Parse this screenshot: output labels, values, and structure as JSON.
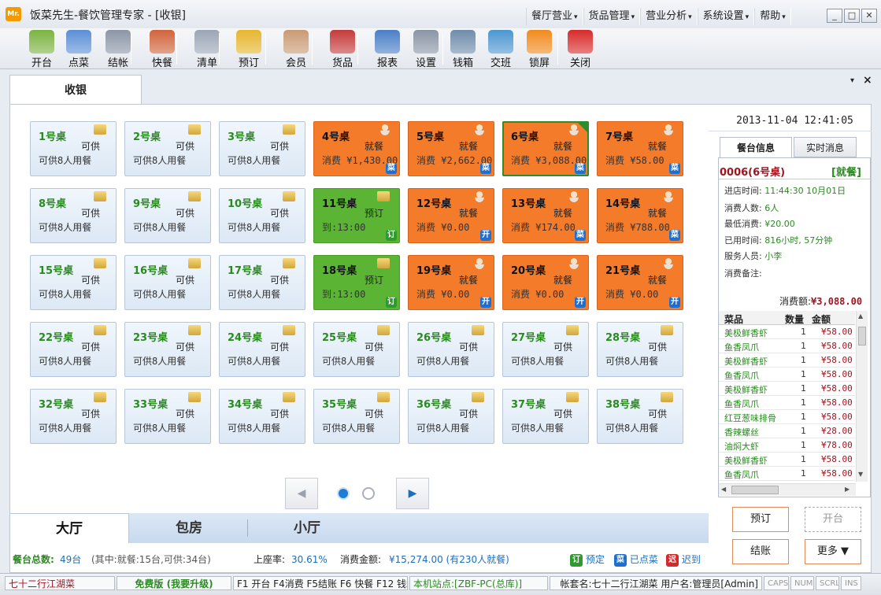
{
  "app": {
    "logo": "Mr.",
    "title": "饭菜先生-餐饮管理专家 - [收银]"
  },
  "menu": [
    "餐厅营业",
    "货品管理",
    "营业分析",
    "系统设置",
    "帮助"
  ],
  "window_buttons": {
    "minimize": "_",
    "maximize": "□",
    "close": "✕"
  },
  "toolbar": [
    {
      "label": "开台",
      "icon": "open-table-icon",
      "color": "#7cb342"
    },
    {
      "label": "点菜",
      "icon": "order-dish-icon",
      "color": "#5b8fd6"
    },
    {
      "label": "结帐",
      "icon": "checkout-icon",
      "color": "#8b96a6"
    },
    {
      "label": "快餐",
      "icon": "fast-food-icon",
      "color": "#d0643b"
    },
    {
      "label": "清单",
      "icon": "list-icon",
      "color": "#9aa6b6"
    },
    {
      "label": "预订",
      "icon": "reservation-clock-icon",
      "color": "#e6b62e"
    },
    {
      "label": "会员",
      "icon": "member-icon",
      "color": "#c99a73"
    },
    {
      "label": "货品",
      "icon": "goods-icon",
      "color": "#c43b3b"
    },
    {
      "label": "报表",
      "icon": "report-icon",
      "color": "#4a7fc7"
    },
    {
      "label": "设置",
      "icon": "settings-gears-icon",
      "color": "#8a95a4"
    },
    {
      "label": "钱箱",
      "icon": "cash-box-icon",
      "color": "#6f8cab"
    },
    {
      "label": "交班",
      "icon": "shift-handover-icon",
      "color": "#4c96d1"
    },
    {
      "label": "锁屏",
      "icon": "lock-screen-icon",
      "color": "#f08a1c"
    },
    {
      "label": "关闭",
      "icon": "power-icon",
      "color": "#d82b2b"
    }
  ],
  "main_tab": "收银",
  "tables": [
    {
      "name": "1号桌",
      "status": "可供",
      "info": "可供8人用餐",
      "state": "free"
    },
    {
      "name": "2号桌",
      "status": "可供",
      "info": "可供8人用餐",
      "state": "free"
    },
    {
      "name": "3号桌",
      "status": "可供",
      "info": "可供8人用餐",
      "state": "free"
    },
    {
      "name": "4号桌",
      "status": "就餐",
      "info": "消费 ¥1,430.00",
      "state": "dining",
      "badge": "菜"
    },
    {
      "name": "5号桌",
      "status": "就餐",
      "info": "消费 ¥2,662.00",
      "state": "dining",
      "badge": "菜"
    },
    {
      "name": "6号桌",
      "status": "就餐",
      "info": "消费 ¥3,088.00",
      "state": "dining",
      "badge": "菜",
      "selected": true
    },
    {
      "name": "7号桌",
      "status": "就餐",
      "info": "消费 ¥58.00",
      "state": "dining",
      "badge": "菜"
    },
    {
      "name": "8号桌",
      "status": "可供",
      "info": "可供8人用餐",
      "state": "free"
    },
    {
      "name": "9号桌",
      "status": "可供",
      "info": "可供8人用餐",
      "state": "free"
    },
    {
      "name": "10号桌",
      "status": "可供",
      "info": "可供8人用餐",
      "state": "free"
    },
    {
      "name": "11号桌",
      "status": "预订",
      "info": "到:13:00",
      "state": "reserved",
      "badge": "订"
    },
    {
      "name": "12号桌",
      "status": "就餐",
      "info": "消费 ¥0.00",
      "state": "dining",
      "badge": "开"
    },
    {
      "name": "13号桌",
      "status": "就餐",
      "info": "消费 ¥174.00",
      "state": "dining",
      "badge": "菜"
    },
    {
      "name": "14号桌",
      "status": "就餐",
      "info": "消费 ¥788.00",
      "state": "dining",
      "badge": "菜"
    },
    {
      "name": "15号桌",
      "status": "可供",
      "info": "可供8人用餐",
      "state": "free"
    },
    {
      "name": "16号桌",
      "status": "可供",
      "info": "可供8人用餐",
      "state": "free"
    },
    {
      "name": "17号桌",
      "status": "可供",
      "info": "可供8人用餐",
      "state": "free"
    },
    {
      "name": "18号桌",
      "status": "预订",
      "info": "到:13:00",
      "state": "reserved",
      "badge": "订"
    },
    {
      "name": "19号桌",
      "status": "就餐",
      "info": "消费 ¥0.00",
      "state": "dining",
      "badge": "开"
    },
    {
      "name": "20号桌",
      "status": "就餐",
      "info": "消费 ¥0.00",
      "state": "dining",
      "badge": "开"
    },
    {
      "name": "21号桌",
      "status": "就餐",
      "info": "消费 ¥0.00",
      "state": "dining",
      "badge": "开"
    },
    {
      "name": "22号桌",
      "status": "可供",
      "info": "可供8人用餐",
      "state": "free"
    },
    {
      "name": "23号桌",
      "status": "可供",
      "info": "可供8人用餐",
      "state": "free"
    },
    {
      "name": "24号桌",
      "status": "可供",
      "info": "可供8人用餐",
      "state": "free"
    },
    {
      "name": "25号桌",
      "status": "可供",
      "info": "可供8人用餐",
      "state": "free"
    },
    {
      "name": "26号桌",
      "status": "可供",
      "info": "可供8人用餐",
      "state": "free"
    },
    {
      "name": "27号桌",
      "status": "可供",
      "info": "可供8人用餐",
      "state": "free"
    },
    {
      "name": "28号桌",
      "status": "可供",
      "info": "可供8人用餐",
      "state": "free"
    },
    {
      "name": "32号桌",
      "status": "可供",
      "info": "可供8人用餐",
      "state": "free"
    },
    {
      "name": "33号桌",
      "status": "可供",
      "info": "可供8人用餐",
      "state": "free"
    },
    {
      "name": "34号桌",
      "status": "可供",
      "info": "可供8人用餐",
      "state": "free"
    },
    {
      "name": "35号桌",
      "status": "可供",
      "info": "可供8人用餐",
      "state": "free"
    },
    {
      "name": "36号桌",
      "status": "可供",
      "info": "可供8人用餐",
      "state": "free"
    },
    {
      "name": "37号桌",
      "status": "可供",
      "info": "可供8人用餐",
      "state": "free"
    },
    {
      "name": "38号桌",
      "status": "可供",
      "info": "可供8人用餐",
      "state": "free"
    }
  ],
  "pager": {
    "prev": "◀",
    "next": "▶"
  },
  "area_tabs": [
    "大厅",
    "包房",
    "小厅"
  ],
  "summary": {
    "total_label": "餐台总数:",
    "total_value": "49台",
    "total_detail": "(其中:就餐:15台,可供:34台)",
    "occupancy_label": "上座率:",
    "occupancy_value": "30.61%",
    "amount_label": "消费金额:",
    "amount_value": "¥15,274.00 (有230人就餐)",
    "legend": [
      {
        "badge": "订",
        "label": "预定",
        "color": "#2f9a2f"
      },
      {
        "badge": "菜",
        "label": "已点菜",
        "color": "#1f6fd1"
      },
      {
        "badge": "迟",
        "label": "迟到",
        "color": "#d22b2b"
      }
    ]
  },
  "right_panel": {
    "datetime": "2013-11-04 12:41:05",
    "tabs": [
      "餐台信息",
      "实时消息"
    ],
    "order_id": "0006(6号桌)",
    "order_state": "[就餐]",
    "fields": [
      {
        "label": "进店时间:",
        "value": "11:44:30 10月01日"
      },
      {
        "label": "消费人数:",
        "value": "6人"
      },
      {
        "label": "最低消费:",
        "value": "¥20.00"
      },
      {
        "label": "已用时间:",
        "value": "816小时, 57分钟"
      },
      {
        "label": "服务人员:",
        "value": "小李"
      },
      {
        "label": "消费备注:",
        "value": ""
      }
    ],
    "total_label": "消费额:",
    "total_value": "¥3,088.00",
    "order_columns": [
      "菜品",
      "数量",
      "金额"
    ],
    "order_items": [
      {
        "name": "美极鲜香虾",
        "qty": "1",
        "amount": "¥58.00"
      },
      {
        "name": "鱼香凤爪",
        "qty": "1",
        "amount": "¥58.00"
      },
      {
        "name": "美极鲜香虾",
        "qty": "1",
        "amount": "¥58.00"
      },
      {
        "name": "鱼香凤爪",
        "qty": "1",
        "amount": "¥58.00"
      },
      {
        "name": "美极鲜香虾",
        "qty": "1",
        "amount": "¥58.00"
      },
      {
        "name": "鱼香凤爪",
        "qty": "1",
        "amount": "¥58.00"
      },
      {
        "name": "红豆葱味排骨",
        "qty": "1",
        "amount": "¥58.00"
      },
      {
        "name": "香辣螺丝",
        "qty": "1",
        "amount": "¥28.00"
      },
      {
        "name": "油焖大虾",
        "qty": "1",
        "amount": "¥78.00"
      },
      {
        "name": "美极鲜香虾",
        "qty": "1",
        "amount": "¥58.00"
      },
      {
        "name": "鱼香凤爪",
        "qty": "1",
        "amount": "¥58.00"
      }
    ],
    "buttons": {
      "reserve": "预订",
      "open": "开台",
      "checkout": "结账",
      "more": "更多 ▼"
    }
  },
  "statusbar": {
    "shop": "七十二行江湖菜",
    "edition": "免费版 (我要升级)",
    "shortcuts": "F1 开台 F4消费 F5结账 F6 快餐 F12 钱箱",
    "site": "本机站点:[ZBF-PC(总库)]",
    "account": "帐套名:七十二行江湖菜 用户名:管理员[Admin]",
    "caps": "CAPS",
    "num": "NUM",
    "scrl": "SCRL",
    "ins": "INS"
  }
}
